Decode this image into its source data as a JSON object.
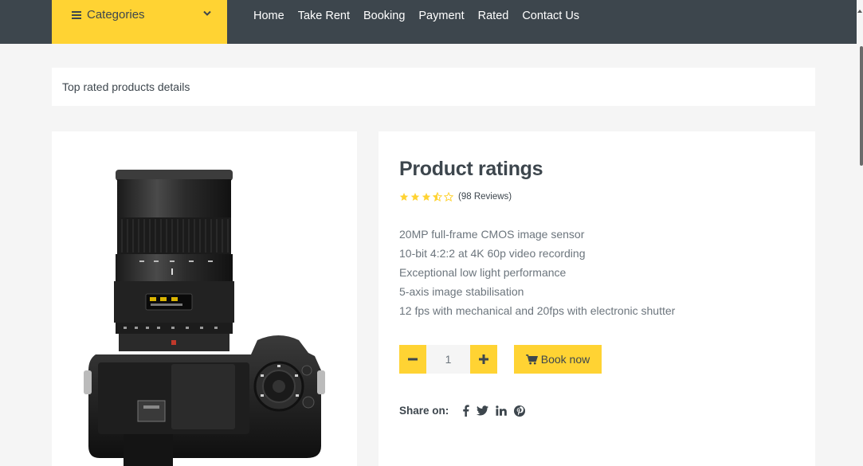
{
  "nav": {
    "categories_label": "Categories",
    "links": [
      "Home",
      "Take Rent",
      "Booking",
      "Payment",
      "Rated",
      "Contact Us"
    ]
  },
  "breadcrumb": {
    "text": "Top rated products details"
  },
  "product": {
    "title": "Product ratings",
    "rating": 3.5,
    "max_rating": 5,
    "reviews_text": "(98 Reviews)",
    "features": [
      "20MP full-frame CMOS image sensor",
      "10-bit 4:2:2 at 4K 60p video recording",
      "Exceptional low light performance",
      "5-axis image stabilisation",
      "12 fps with mechanical and 20fps with electronic shutter"
    ],
    "quantity": "1",
    "book_label": "Book now",
    "share_label": "Share on:"
  },
  "colors": {
    "accent": "#ffd333",
    "dark": "#3d464d",
    "muted": "#6c757d",
    "background": "#f5f5f5"
  },
  "icons": {
    "menu": "bars-icon",
    "dropdown": "chevron-down-icon",
    "minus": "minus-icon",
    "plus": "plus-icon",
    "cart": "shopping-cart-icon",
    "share": [
      "facebook-icon",
      "twitter-icon",
      "linkedin-icon",
      "pinterest-icon"
    ]
  }
}
